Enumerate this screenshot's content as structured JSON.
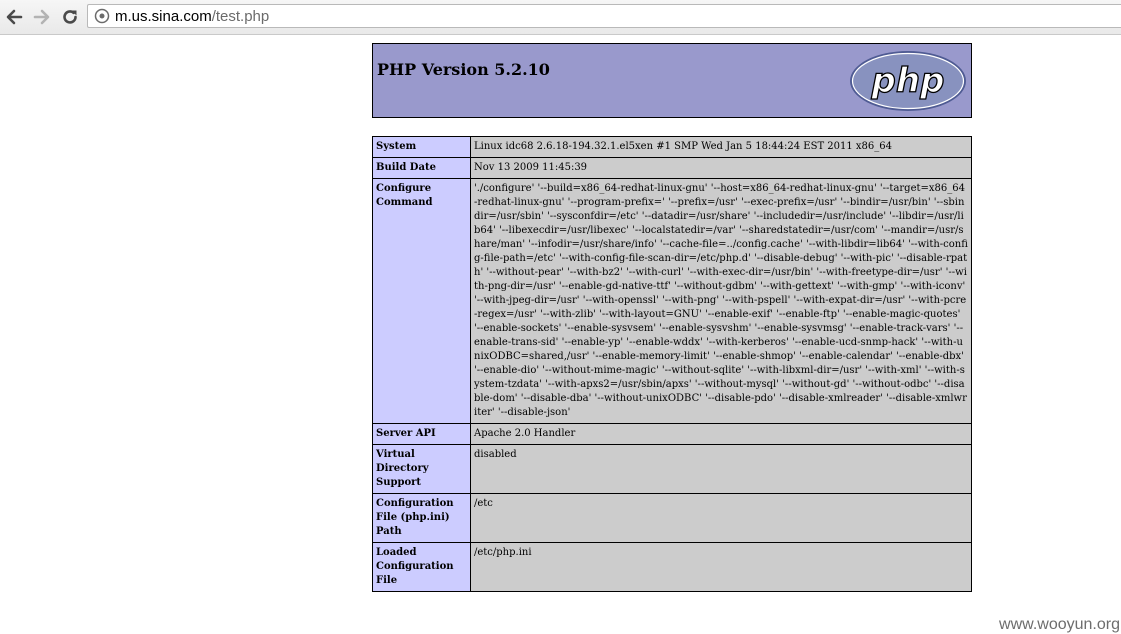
{
  "browser": {
    "url_host": "m.us.sina.com",
    "url_path": "/test.php"
  },
  "header": {
    "title": "PHP Version 5.2.10",
    "logo_text": "php"
  },
  "rows": [
    {
      "key": "System",
      "value": "Linux idc68 2.6.18-194.32.1.el5xen #1 SMP Wed Jan 5 18:44:24 EST 2011 x86_64"
    },
    {
      "key": "Build Date",
      "value": "Nov 13 2009 11:45:39"
    },
    {
      "key": "Configure Command",
      "value": "'./configure' '--build=x86_64-redhat-linux-gnu' '--host=x86_64-redhat-linux-gnu' '--target=x86_64-redhat-linux-gnu' '--program-prefix=' '--prefix=/usr' '--exec-prefix=/usr' '--bindir=/usr/bin' '--sbindir=/usr/sbin' '--sysconfdir=/etc' '--datadir=/usr/share' '--includedir=/usr/include' '--libdir=/usr/lib64' '--libexecdir=/usr/libexec' '--localstatedir=/var' '--sharedstatedir=/usr/com' '--mandir=/usr/share/man' '--infodir=/usr/share/info' '--cache-file=../config.cache' '--with-libdir=lib64' '--with-config-file-path=/etc' '--with-config-file-scan-dir=/etc/php.d' '--disable-debug' '--with-pic' '--disable-rpath' '--without-pear' '--with-bz2' '--with-curl' '--with-exec-dir=/usr/bin' '--with-freetype-dir=/usr' '--with-png-dir=/usr' '--enable-gd-native-ttf' '--without-gdbm' '--with-gettext' '--with-gmp' '--with-iconv' '--with-jpeg-dir=/usr' '--with-openssl' '--with-png' '--with-pspell' '--with-expat-dir=/usr' '--with-pcre-regex=/usr' '--with-zlib' '--with-layout=GNU' '--enable-exif' '--enable-ftp' '--enable-magic-quotes' '--enable-sockets' '--enable-sysvsem' '--enable-sysvshm' '--enable-sysvmsg' '--enable-track-vars' '--enable-trans-sid' '--enable-yp' '--enable-wddx' '--with-kerberos' '--enable-ucd-snmp-hack' '--with-unixODBC=shared,/usr' '--enable-memory-limit' '--enable-shmop' '--enable-calendar' '--enable-dbx' '--enable-dio' '--without-mime-magic' '--without-sqlite' '--with-libxml-dir=/usr' '--with-xml' '--with-system-tzdata' '--with-apxs2=/usr/sbin/apxs' '--without-mysql' '--without-gd' '--without-odbc' '--disable-dom' '--disable-dba' '--without-unixODBC' '--disable-pdo' '--disable-xmlreader' '--disable-xmlwriter' '--disable-json'"
    },
    {
      "key": "Server API",
      "value": "Apache 2.0 Handler"
    },
    {
      "key": "Virtual Directory Support",
      "value": "disabled"
    },
    {
      "key": "Configuration File (php.ini) Path",
      "value": "/etc"
    },
    {
      "key": "Loaded Configuration File",
      "value": "/etc/php.ini"
    }
  ],
  "watermark": "www.wooyun.org",
  "colors": {
    "header_bg": "#9999cc",
    "key_bg": "#ccccff",
    "value_bg": "#cccccc",
    "logo_bg": "#6c7eb7"
  },
  "icons": [
    "back-arrow-icon",
    "forward-arrow-icon",
    "reload-icon",
    "page-icon"
  ]
}
